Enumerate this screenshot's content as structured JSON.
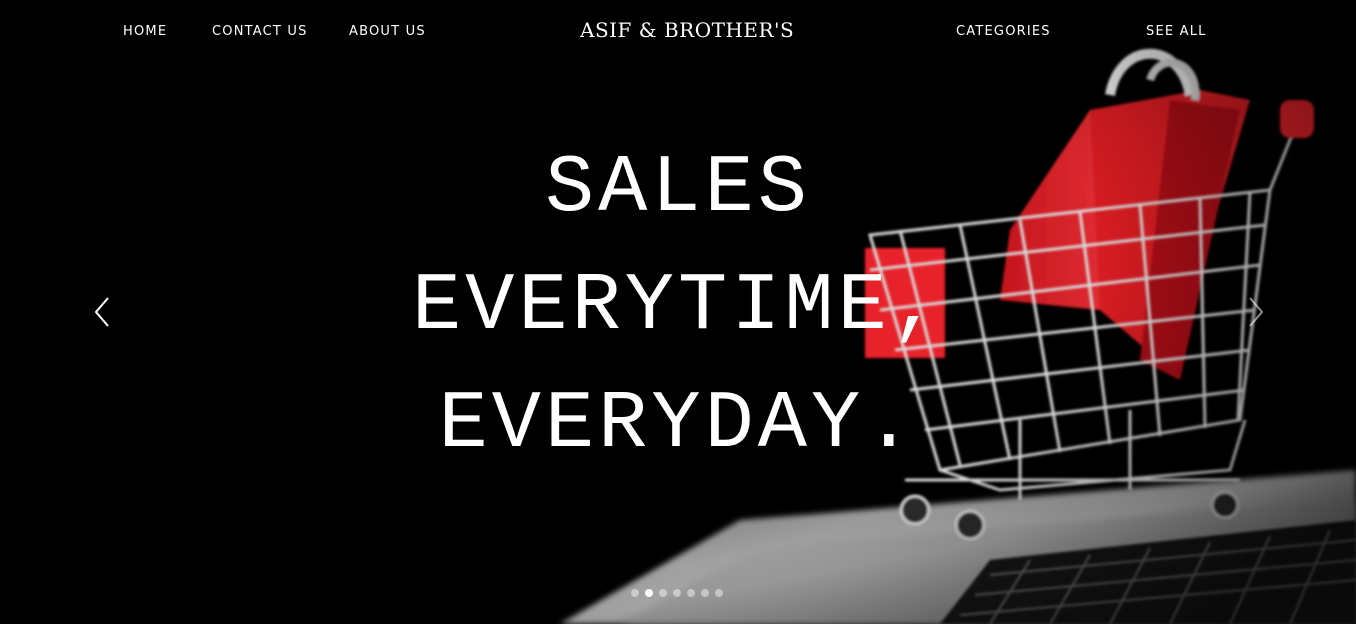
{
  "nav": {
    "left": [
      {
        "label": "HOME"
      },
      {
        "label": "CONTACT US"
      },
      {
        "label": "ABOUT US"
      }
    ],
    "brand": "ASIF & BROTHER'S",
    "right": [
      {
        "label": "CATEGORIES"
      },
      {
        "label": "SEE ALL"
      }
    ]
  },
  "hero": {
    "lines": [
      "SALES",
      "EVERYTIME,",
      "EVERYDAY."
    ],
    "prev_icon": "chevron-left-icon",
    "next_icon": "chevron-right-icon",
    "slide_count": 7,
    "active_slide": 2
  },
  "colors": {
    "background": "#000000",
    "text": "#ffffff",
    "cart_red": "#e8222a",
    "laptop_gray": "#8a8a8a"
  }
}
